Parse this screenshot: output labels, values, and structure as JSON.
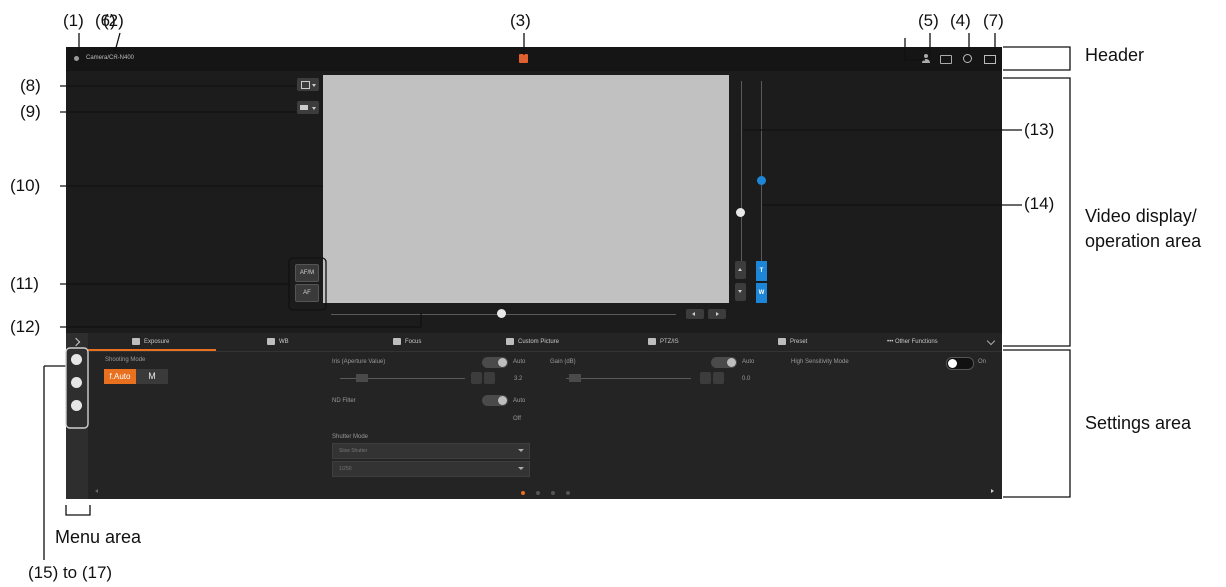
{
  "callouts": {
    "c1": "(1)",
    "c6": "(6)",
    "c2": "(2)",
    "c3": "(3)",
    "c5": "(5)",
    "c4": "(4)",
    "c7": "(7)",
    "c8": "(8)",
    "c9": "(9)",
    "c10": "(10)",
    "c11": "(11)",
    "c12": "(12)",
    "c13": "(13)",
    "c14": "(14)",
    "c15_17": "(15) to (17)"
  },
  "regions": {
    "header": "Header",
    "video_line1": "Video display/",
    "video_line2": "operation area",
    "settings": "Settings area",
    "menu": "Menu area"
  },
  "app": {
    "camera_name": "Camera/CR-N400",
    "tabs": [
      "Exposure",
      "WB",
      "Focus",
      "Custom Picture",
      "PTZ/IS",
      "Preset",
      "••• Other Functions"
    ],
    "zoom_t": "T",
    "zoom_w": "W",
    "af_label": "AF/M",
    "af_sub": "AF",
    "shooting_mode_label": "Shooting Mode",
    "mode_auto": "f.Auto",
    "mode_manual": "M",
    "iris_label": "Iris (Aperture Value)",
    "iris_auto": "Auto",
    "iris_value": "3.2",
    "nd_label": "ND Filter",
    "nd_auto": "Auto",
    "nd_value": "Off",
    "shutter_label": "Shutter Mode",
    "shutter_opt1": "Slow Shutter",
    "shutter_opt2": "1/250",
    "gain_label": "Gain (dB)",
    "gain_auto": "Auto",
    "gain_value": "0.0",
    "high_sens_label": "High Sensitivity Mode",
    "high_sens_value": "On"
  },
  "colors": {
    "accent_orange": "#e8701e",
    "accent_blue": "#1e86d6",
    "record_red": "#e06030"
  }
}
